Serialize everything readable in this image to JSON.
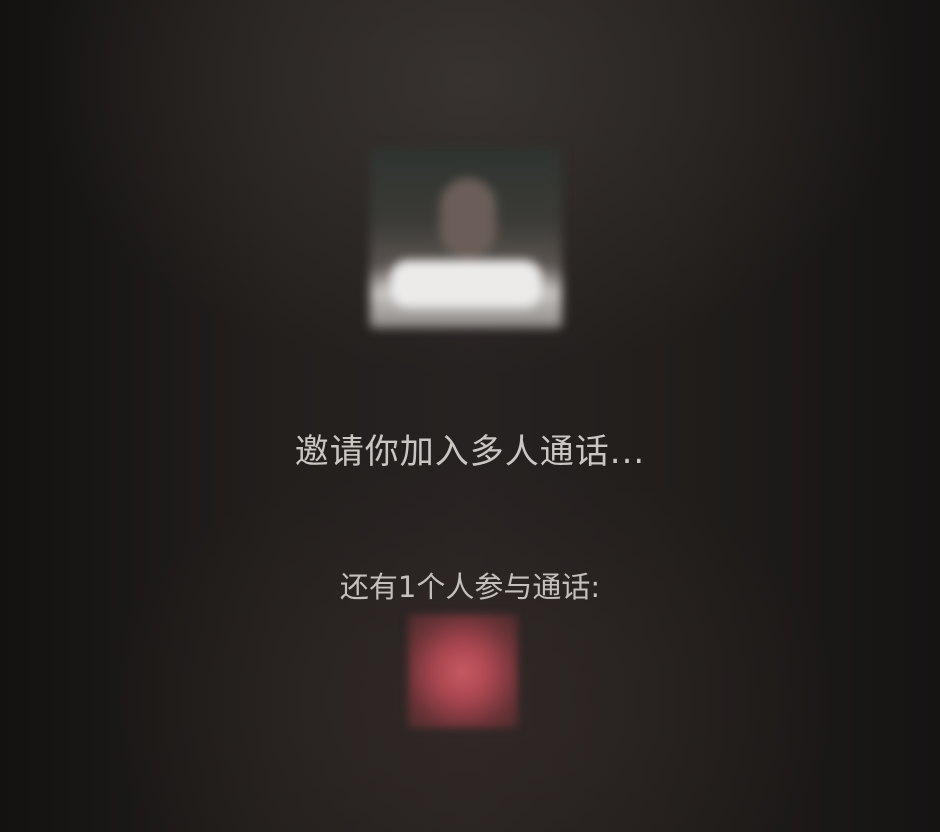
{
  "call": {
    "invite_text": "邀请你加入多人通话...",
    "participants_label": "还有1个人参与通话:"
  },
  "colors": {
    "text": "#c9c6c3",
    "background": "#1d1a19"
  }
}
